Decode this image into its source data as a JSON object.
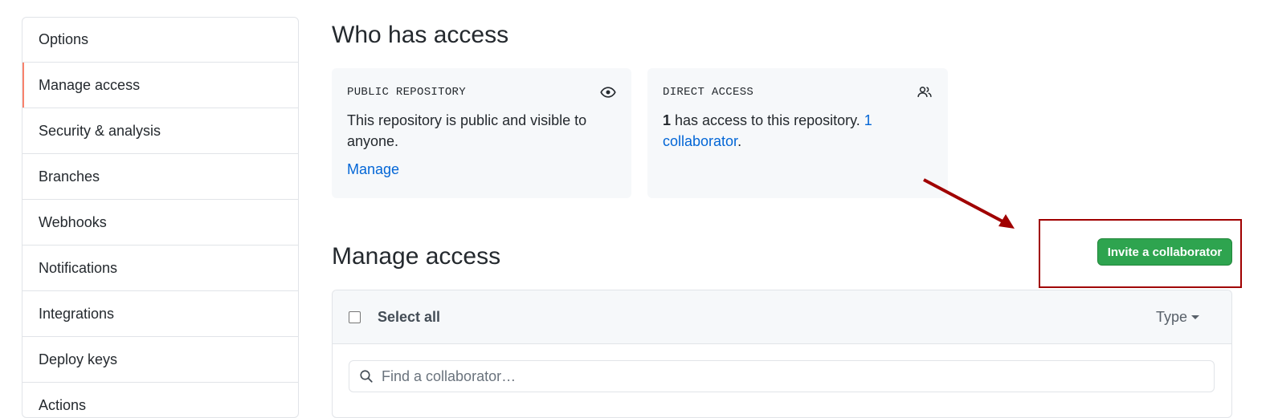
{
  "sidebar": {
    "items": [
      {
        "label": "Options"
      },
      {
        "label": "Manage access"
      },
      {
        "label": "Security & analysis"
      },
      {
        "label": "Branches"
      },
      {
        "label": "Webhooks"
      },
      {
        "label": "Notifications"
      },
      {
        "label": "Integrations"
      },
      {
        "label": "Deploy keys"
      },
      {
        "label": "Actions"
      }
    ]
  },
  "who_has_access": {
    "title": "Who has access",
    "public_card": {
      "label": "PUBLIC REPOSITORY",
      "icon": "eye-icon",
      "text": "This repository is public and visible to anyone.",
      "link": "Manage"
    },
    "direct_card": {
      "label": "DIRECT ACCESS",
      "icon": "people-icon",
      "count": "1",
      "text": " has access to this repository. ",
      "link": "1 collaborator",
      "suffix": "."
    }
  },
  "manage_access": {
    "title": "Manage access",
    "invite_button": "Invite a collaborator",
    "select_all": "Select all",
    "type_filter": "Type",
    "search_placeholder": "Find a collaborator…"
  },
  "colors": {
    "primary_button": "#2ea44f",
    "link": "#0366d6",
    "annotation": "#a00000",
    "selected_indicator": "#f9826c"
  }
}
